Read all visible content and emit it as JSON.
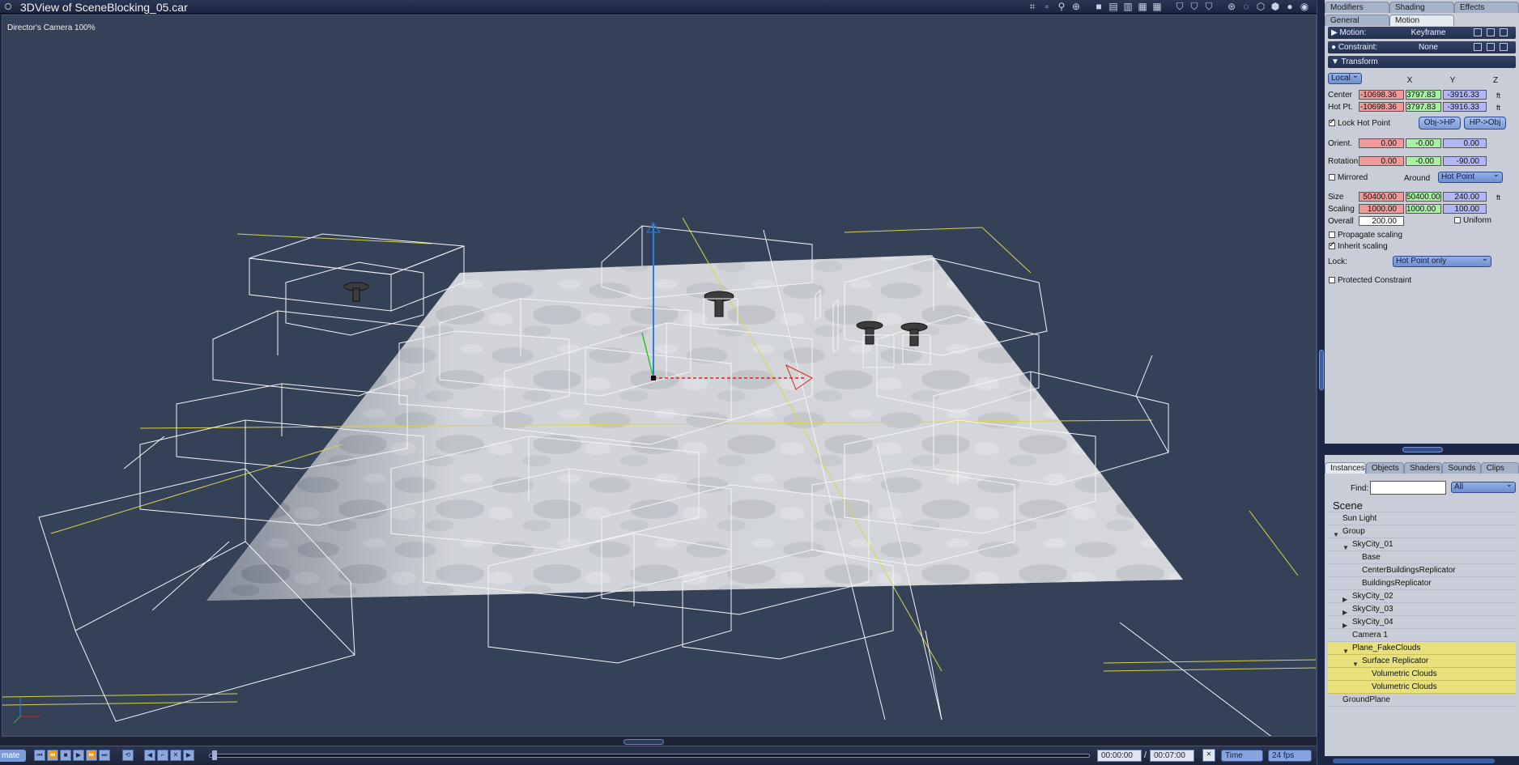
{
  "window": {
    "title": "3DView of SceneBlocking_05.car"
  },
  "viewport": {
    "camera_label": "Director's Camera 100%"
  },
  "toolbar": {
    "icons": [
      "render-area-icon",
      "preview-icon",
      "bones-icon",
      "target-icon",
      "single-view-icon",
      "dual-view-icon",
      "triple-view-icon",
      "quad-view-icon",
      "quad-view-alt-icon",
      "shield-icon",
      "shield-alt-icon",
      "shield-check-icon",
      "compass-icon",
      "dashed-sphere-icon",
      "wire-cube-icon",
      "solid-cube-icon",
      "sphere-shaded-icon",
      "sphere-lit-icon"
    ]
  },
  "transport": {
    "mode": "mate",
    "current_time": "00:00:00",
    "end_time": "00:07:00",
    "time_separator": "/",
    "time_mode": "Time",
    "fps": "24 fps"
  },
  "panel": {
    "tabs_top": [
      "Modifiers",
      "Shading",
      "Effects"
    ],
    "tabs_sub": [
      "General",
      "Motion"
    ],
    "active_sub_tab": "Motion",
    "motion": {
      "label": "Motion:",
      "value": "Keyframe"
    },
    "constraint": {
      "label": "Constraint:",
      "value": "None"
    },
    "transform": {
      "section_label": "Transform",
      "space": "Local",
      "col_x": "X",
      "col_y": "Y",
      "col_z": "Z",
      "center": {
        "label": "Center",
        "x": "-10698.36",
        "y": "3797.83",
        "z": "-3916.33",
        "unit": "ft"
      },
      "hotpt": {
        "label": "Hot Pt.",
        "x": "-10698.36",
        "y": "3797.83",
        "z": "-3916.33",
        "unit": "ft"
      },
      "lock_hot_point": "Lock Hot Point",
      "obj_hp": "Obj->HP",
      "hp_obj": "HP->Obj",
      "orient": {
        "label": "Orient.",
        "x": "0.00",
        "y": "-0.00",
        "z": "0.00"
      },
      "rotation": {
        "label": "Rotation",
        "x": "0.00",
        "y": "-0.00",
        "z": "-90.00"
      },
      "mirrored": "Mirrored",
      "around_label": "Around",
      "around_value": "Hot Point",
      "size": {
        "label": "Size",
        "x": "50400.00",
        "y": "50400.00",
        "z": "240.00",
        "unit": "ft"
      },
      "scaling": {
        "label": "Scaling",
        "x": "1000.00",
        "y": "1000.00",
        "z": "100.00"
      },
      "overall": {
        "label": "Overall",
        "value": "200.00"
      },
      "uniform": "Uniform",
      "propagate_scaling": "Propagate scaling",
      "inherit_scaling": "Inherit scaling",
      "lock_label": "Lock:",
      "lock_value": "Hot Point only",
      "protected_constraint": "Protected Constraint"
    },
    "browser": {
      "tabs": [
        "Instances",
        "Objects",
        "Shaders",
        "Sounds",
        "Clips"
      ],
      "find_label": "Find:",
      "find_value": "",
      "filter": "All",
      "tree": [
        {
          "label": "Scene",
          "indent": 0,
          "root": true,
          "hl": false,
          "tw": ""
        },
        {
          "label": "Sun Light",
          "indent": 12,
          "hl": false,
          "tw": ""
        },
        {
          "label": "Group",
          "indent": 12,
          "hl": false,
          "tw": "▼"
        },
        {
          "label": "SkyCity_01",
          "indent": 24,
          "hl": false,
          "tw": "▼"
        },
        {
          "label": "Base",
          "indent": 36,
          "hl": false,
          "tw": ""
        },
        {
          "label": "CenterBuildingsReplicator",
          "indent": 36,
          "hl": false,
          "tw": ""
        },
        {
          "label": "BuildingsReplicator",
          "indent": 36,
          "hl": false,
          "tw": ""
        },
        {
          "label": "SkyCity_02",
          "indent": 24,
          "hl": false,
          "tw": "▶"
        },
        {
          "label": "SkyCity_03",
          "indent": 24,
          "hl": false,
          "tw": "▶"
        },
        {
          "label": "SkyCity_04",
          "indent": 24,
          "hl": false,
          "tw": "▶"
        },
        {
          "label": "Camera 1",
          "indent": 24,
          "hl": false,
          "tw": ""
        },
        {
          "label": "Plane_FakeClouds",
          "indent": 24,
          "hl": true,
          "tw": "▼"
        },
        {
          "label": "Surface Replicator",
          "indent": 36,
          "hl": true,
          "tw": "▼"
        },
        {
          "label": "Volumetric Clouds",
          "indent": 48,
          "hl": true,
          "tw": ""
        },
        {
          "label": "Volumetric Clouds",
          "indent": 48,
          "hl": true,
          "tw": ""
        },
        {
          "label": "GroundPlane",
          "indent": 12,
          "hl": false,
          "tw": ""
        }
      ]
    }
  },
  "colors": {
    "viewport_bg": "#354157",
    "axis_x": "#e02020",
    "axis_y": "#30c030",
    "axis_z": "#2a7ee0",
    "highlight_row": "#e8e07a"
  }
}
